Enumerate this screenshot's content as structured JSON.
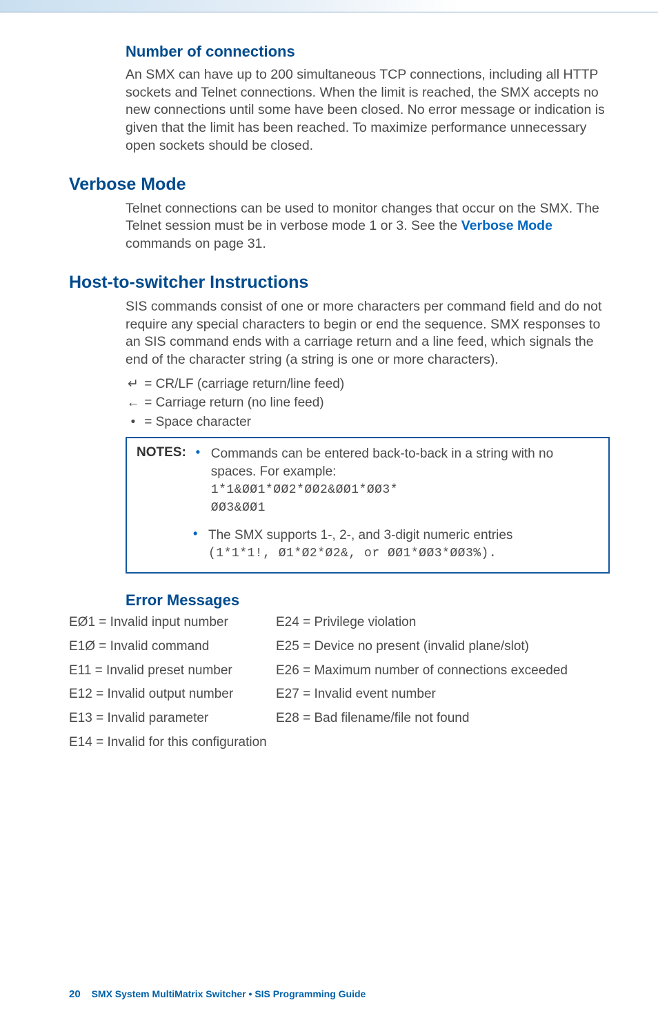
{
  "sections": {
    "num_conn": {
      "heading": "Number of connections",
      "body": "An SMX can have up to 200 simultaneous TCP connections, including all HTTP sockets and Telnet connections. When the limit is reached, the SMX accepts no new connections until some have been closed. No error message or indication is given that the limit has been reached. To maximize performance unnecessary open sockets should be closed."
    },
    "verbose": {
      "heading": "Verbose Mode",
      "body_pre": "Telnet connections can be used to monitor changes that occur on the SMX. The Telnet session must be in verbose mode 1 or 3. See the ",
      "link": "Verbose Mode",
      "body_post": " commands on page 31."
    },
    "host": {
      "heading": "Host-to-switcher Instructions",
      "body": "SIS commands consist of one or more characters per command field and do not require any special characters to begin or end the sequence. SMX responses to an SIS command ends with a carriage return and a line feed, which signals the end of the character string (a string is one or more characters).",
      "defs": {
        "crlf_glyph": "↵",
        "crlf_text": " = CR/LF (carriage return/line feed)",
        "cr_glyph": "←",
        "cr_text": " = Carriage return (no line feed)",
        "sp_glyph": "•",
        "sp_text": " = Space character"
      },
      "notes_label": "NOTES:",
      "notes": {
        "b1_line1": "Commands can be entered back-to-back in a string with no spaces. For example:",
        "b1_code1": "1*1&ØØ1*ØØ2*ØØ2&ØØ1*ØØ3*",
        "b1_code2": "ØØ3&ØØ1",
        "b2_line1": "The SMX supports 1-, 2-, and 3-digit numeric entries",
        "b2_code": "(1*1*1!, Ø1*Ø2*Ø2&, or ØØ1*ØØ3*ØØ3%)."
      }
    },
    "errors": {
      "heading": "Error Messages",
      "rows": [
        {
          "left": "EØ1 = Invalid input number",
          "right": "E24 = Privilege violation"
        },
        {
          "left": "E1Ø = Invalid command",
          "right": "E25 = Device no present (invalid plane/slot)"
        },
        {
          "left": "E11 = Invalid preset number",
          "right": "E26 = Maximum number of connections exceeded"
        },
        {
          "left": "E12 = Invalid output number",
          "right": "E27 = Invalid event number"
        },
        {
          "left": "E13 = Invalid parameter",
          "right": "E28 = Bad filename/file not found"
        },
        {
          "left": "E14 = Invalid for this configuration",
          "right": ""
        }
      ]
    }
  },
  "footer": {
    "page": "20",
    "title": "SMX System MultiMatrix Switcher • SIS Programming Guide"
  }
}
